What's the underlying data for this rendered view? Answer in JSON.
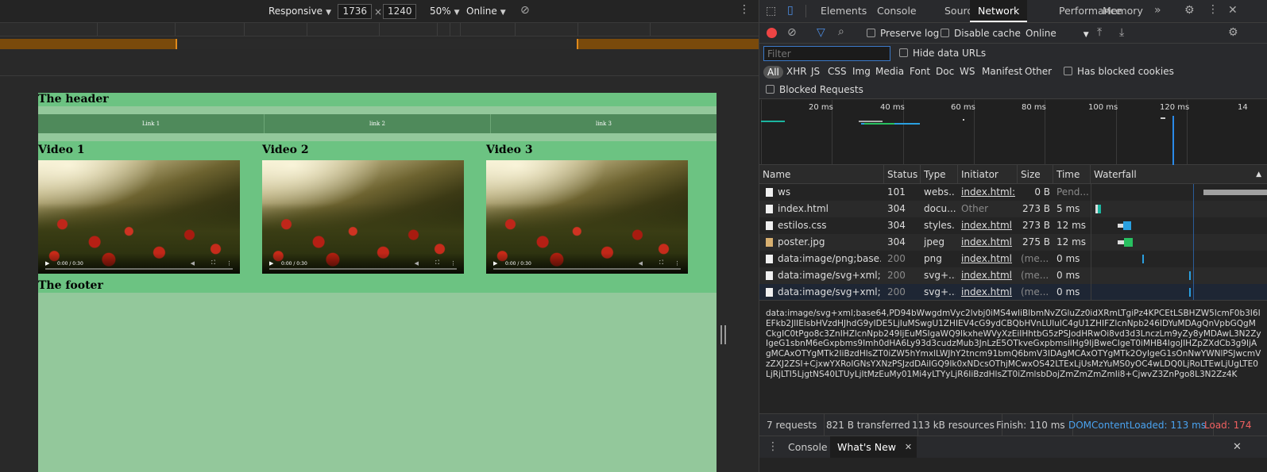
{
  "device_toolbar": {
    "device": "Responsive",
    "width": "1736",
    "height": "1240",
    "times": "×",
    "zoom": "50%",
    "throttle": "Online"
  },
  "page": {
    "header": "The header",
    "nav": [
      "Link 1",
      "link 2",
      "link 3"
    ],
    "videos": [
      {
        "title": "Video 1",
        "time": "0:00 / 0:30"
      },
      {
        "title": "Video 2",
        "time": "0:00 / 0:30"
      },
      {
        "title": "Video 3",
        "time": "0:00 / 0:30"
      }
    ],
    "footer": "The footer"
  },
  "devtools": {
    "tabs": [
      "Elements",
      "Console",
      "Sources",
      "Network",
      "Performance",
      "Memory"
    ],
    "active_tab": "Network",
    "toolbar": {
      "preserve_log": "Preserve log",
      "disable_cache": "Disable cache",
      "throttle": "Online"
    },
    "filter": {
      "placeholder": "Filter",
      "hide_data_urls": "Hide data URLs",
      "types": [
        "All",
        "XHR",
        "JS",
        "CSS",
        "Img",
        "Media",
        "Font",
        "Doc",
        "WS",
        "Manifest",
        "Other"
      ],
      "has_blocked_cookies": "Has blocked cookies",
      "blocked_requests": "Blocked Requests"
    },
    "overview_labels": [
      "20 ms",
      "40 ms",
      "60 ms",
      "80 ms",
      "100 ms",
      "120 ms",
      "14"
    ],
    "columns": [
      "Name",
      "Status",
      "Type",
      "Initiator",
      "Size",
      "Time",
      "Waterfall"
    ],
    "requests": [
      {
        "name": "ws",
        "status": "101",
        "type": "webs...",
        "initiator": "index.html:...",
        "size": "0 B",
        "time": "Pend..."
      },
      {
        "name": "index.html",
        "status": "304",
        "type": "docu...",
        "initiator": "Other",
        "size": "273 B",
        "time": "5 ms"
      },
      {
        "name": "estilos.css",
        "status": "304",
        "type": "styles...",
        "initiator": "index.html",
        "size": "273 B",
        "time": "12 ms"
      },
      {
        "name": "poster.jpg",
        "status": "304",
        "type": "jpeg",
        "initiator": "index.html",
        "size": "275 B",
        "time": "12 ms"
      },
      {
        "name": "data:image/png;base...",
        "status": "200",
        "type": "png",
        "initiator": "index.html",
        "size": "(me...",
        "time": "0 ms"
      },
      {
        "name": "data:image/svg+xml;...",
        "status": "200",
        "type": "svg+...",
        "initiator": "index.html",
        "size": "(me...",
        "time": "0 ms"
      },
      {
        "name": "data:image/svg+xml;...",
        "status": "200",
        "type": "svg+...",
        "initiator": "index.html",
        "size": "(me...",
        "time": "0 ms"
      }
    ],
    "preview_text": "data:image/svg+xml;base64,PD94bWwgdmVyc2lvbj0iMS4wIiBlbmNvZGluZz0idXRmLTgiPz4KPCEtLSBHZW5lcmF0b3I6IEFkb2JlIElsbHVzdHJhdG9yIDE5LjIuMSwgU1ZHIEV4cG9ydCBQbHVnLUluIC4gU1ZHIFZlcnNpb246IDYuMDAgQnVpbGQgMCkgIC0tPgo8c3ZnIHZlcnNpb249IjEuMSIgaWQ9IkxheWVyXzEiIHhtbG5zPSJodHRwOi8vd3d3LnczLm9yZy8yMDAwL3N2ZyIgeG1sbnM6eGxpbms9Imh0dHA6Ly93d3cudzMub3JnLzE5OTkveGxpbmsiIHg9IjBweCIgeT0iMHB4IgoJIHZpZXdCb3g9IjAgMCAxOTYgMTk2IiBzdHlsZT0iZW5hYmxlLWJhY2tncm91bmQ6bmV3IDAgMCAxOTYgMTk2OyIgeG1sOnNwYWNlPSJwcmVzZXJ2ZSI+CjxwYXRoIGNsYXNzPSJzdDAiIGQ9Ik0xNDcsOThjMCwxOS42LTExLjUsMzYuMS0yOC4wLDQ0LjRoLTEwLjUgLTE0LjRjLTI5LjgtNS40LTUyLjItMzEuMy01Mi4yLTYyLjR6IiBzdHlsZT0iZmlsbDojZmZmZmZmIi8+CjwvZ3ZnPgo8L3N2Zz4K",
    "status_bar": {
      "requests": "7 requests",
      "transferred": "821 B transferred",
      "resources": "113 kB resources",
      "finish": "Finish: 110 ms",
      "dcl": "DOMContentLoaded: 113 ms",
      "load": "Load: 174"
    },
    "drawer_tabs": [
      "Console",
      "What's New"
    ],
    "colors": {
      "dcl_blue": "#4aa3f0",
      "load_red": "#f06060",
      "page_green": "#93c89b",
      "header_green": "#6cc382",
      "nav_green": "#4f8a5b"
    }
  }
}
